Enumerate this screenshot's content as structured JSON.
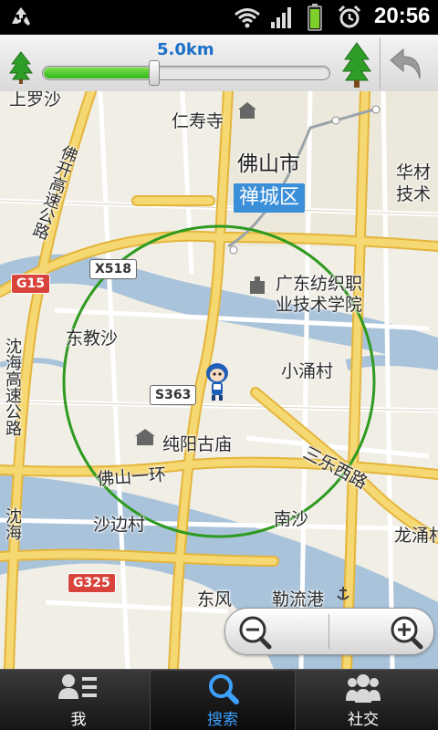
{
  "status_bar": {
    "time": "20:56",
    "icons": [
      "recycle-icon",
      "wifi-icon",
      "signal-icon",
      "battery-icon",
      "alarm-icon"
    ]
  },
  "range_bar": {
    "range_label": "5.0km",
    "slider_fraction": 0.39,
    "icons": [
      "tree-small-icon",
      "tree-large-icon",
      "back-arrow-icon"
    ]
  },
  "map": {
    "labels": {
      "foshan_city": "佛山市",
      "chancheng_district": "禅城区",
      "guangdong_textile": "广东纺织职",
      "guangdong_textile_2": "业技术学院",
      "renshou_temple": "仁寿寺",
      "xiaochong_village": "小涌村",
      "chunyang_temple": "纯阳古庙",
      "shabian_village": "沙边村",
      "dongfeng": "东风",
      "leliugang": "勒流港",
      "nansha": "南沙",
      "longyong": "龙涌村",
      "shangluo_sha": "上罗沙",
      "dongao_sha": "东教沙",
      "huacai_1": "华材",
      "huacai_2": "技术",
      "foshan_kai_expressway": "佛开高速公路",
      "shen_hai_expressway": "沈海高速公路",
      "foshan_ring": "佛山一环",
      "sanle_road": "三乐西路",
      "zhen_hai": "沈海"
    },
    "shields": {
      "g15": "G15",
      "x518": "X518",
      "s363": "S363",
      "g325": "G325"
    },
    "accent_circle_color": "#2e9a1f",
    "water_color": "#a9c3db",
    "major_road_color": "#f2c94c"
  },
  "zoom": {
    "icons": [
      "zoom-out-icon",
      "zoom-in-icon"
    ]
  },
  "bottom_nav": {
    "items": [
      {
        "label": "我",
        "icon": "profile-list-icon",
        "active": false
      },
      {
        "label": "搜索",
        "icon": "search-icon",
        "active": true
      },
      {
        "label": "社交",
        "icon": "people-icon",
        "active": false
      }
    ],
    "active_color": "#3da2ff"
  }
}
